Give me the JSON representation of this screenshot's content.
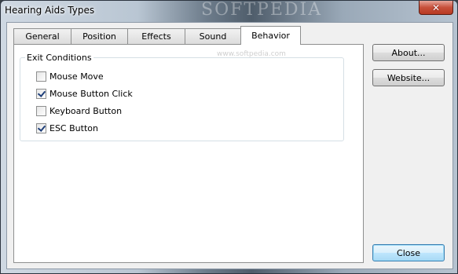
{
  "window": {
    "title": "Hearing Aids Types",
    "watermark": "SOFTPEDIA",
    "close_glyph": "✕"
  },
  "tabs": [
    {
      "label": "General",
      "active": false
    },
    {
      "label": "Position",
      "active": false
    },
    {
      "label": "Effects",
      "active": false
    },
    {
      "label": "Sound",
      "active": false
    },
    {
      "label": "Behavior",
      "active": true
    }
  ],
  "panel": {
    "watermark_sub": "www.softpedia.com",
    "group_label": "Exit Conditions",
    "options": [
      {
        "label": "Mouse Move",
        "checked": false
      },
      {
        "label": "Mouse Button Click",
        "checked": true
      },
      {
        "label": "Keyboard Button",
        "checked": false
      },
      {
        "label": "ESC Button",
        "checked": true
      }
    ]
  },
  "buttons": {
    "about": "About...",
    "website": "Website...",
    "close": "Close"
  }
}
